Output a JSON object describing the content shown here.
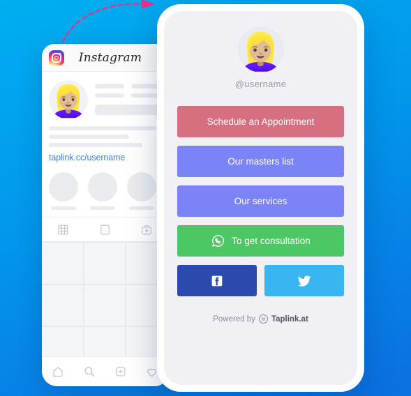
{
  "background": {
    "gradient_from": "#00aff0",
    "gradient_to": "#0b6fe0"
  },
  "annotation": {
    "arrow_color": "#ef2d8a",
    "arrow_name": "dashed-curved-arrow"
  },
  "instagram_phone": {
    "logo_icon": "instagram-logo-icon",
    "wordmark": "Instagram",
    "avatar_emoji": "👱🏼‍♀️",
    "bio_link": "taplink.cc/username",
    "stories_count": 4,
    "tabs": [
      {
        "icon": "grid-icon",
        "label": "Grid"
      },
      {
        "icon": "portrait-icon",
        "label": "Tagged"
      },
      {
        "icon": "igtv-icon",
        "label": "IGTV"
      }
    ],
    "grid_cells": 9,
    "nav": [
      {
        "icon": "home-icon",
        "label": "Home"
      },
      {
        "icon": "search-icon",
        "label": "Search"
      },
      {
        "icon": "add-icon",
        "label": "Add"
      },
      {
        "icon": "heart-icon",
        "label": "Activity"
      }
    ]
  },
  "taplink_phone": {
    "avatar_emoji": "👱🏼‍♀️",
    "username": "@username",
    "buttons": [
      {
        "label": "Schedule an Appointment",
        "color": "#d4707f",
        "icon": null
      },
      {
        "label": "Our masters list",
        "color": "#7b84f5",
        "icon": null
      },
      {
        "label": "Our services",
        "color": "#7b84f5",
        "icon": null
      },
      {
        "label": "To get consultation",
        "color": "#4cc763",
        "icon": "whatsapp-icon"
      }
    ],
    "social": [
      {
        "name": "facebook",
        "icon": "facebook-icon",
        "color": "#2a4bad"
      },
      {
        "name": "twitter",
        "icon": "twitter-icon",
        "color": "#38b6f2"
      }
    ],
    "footer": {
      "prefix": "Powered by",
      "brand": "Taplink.at",
      "icon": "taplink-logo-icon"
    }
  }
}
